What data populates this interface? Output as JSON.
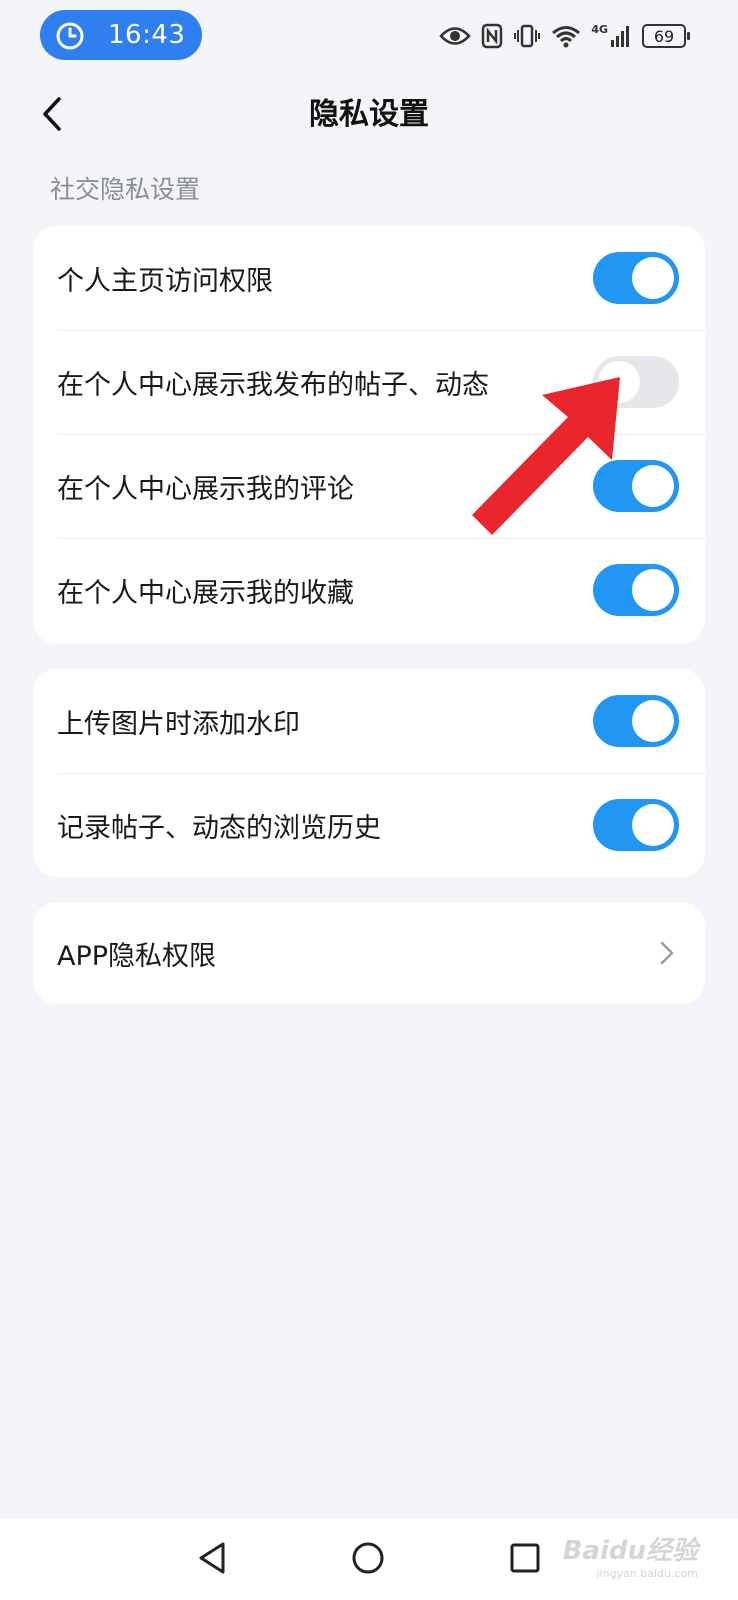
{
  "status_bar": {
    "time": "16:43",
    "battery": "69",
    "network": "4G",
    "icons": [
      "timer-icon",
      "eye-icon",
      "nfc-icon",
      "vibrate-icon",
      "wifi-icon",
      "signal-icon",
      "battery-icon"
    ]
  },
  "header": {
    "title": "隐私设置",
    "back_icon": "chevron-left-icon"
  },
  "section_label": "社交隐私设置",
  "group1": [
    {
      "label": "个人主页访问权限",
      "enabled": true
    },
    {
      "label": "在个人中心展示我发布的帖子、动态",
      "enabled": false
    },
    {
      "label": "在个人中心展示我的评论",
      "enabled": true
    },
    {
      "label": "在个人中心展示我的收藏",
      "enabled": true
    }
  ],
  "group2": [
    {
      "label": "上传图片时添加水印",
      "enabled": true
    },
    {
      "label": "记录帖子、动态的浏览历史",
      "enabled": true
    }
  ],
  "group3": [
    {
      "label": "APP隐私权限",
      "icon": "chevron-right-icon"
    }
  ],
  "annotation": {
    "icon": "red-arrow-icon",
    "color": "#e8262b"
  },
  "nav_bar": {
    "icons": [
      "nav-back-icon",
      "nav-home-icon",
      "nav-recents-icon"
    ]
  },
  "watermark": {
    "text": "Baidu经验",
    "subtext": "jingyan.baidu.com"
  },
  "colors": {
    "background": "#f3f5f8",
    "accent": "#2196f3",
    "toggle_off": "#e6e7ea",
    "status_pill": "#2f7ff0"
  }
}
